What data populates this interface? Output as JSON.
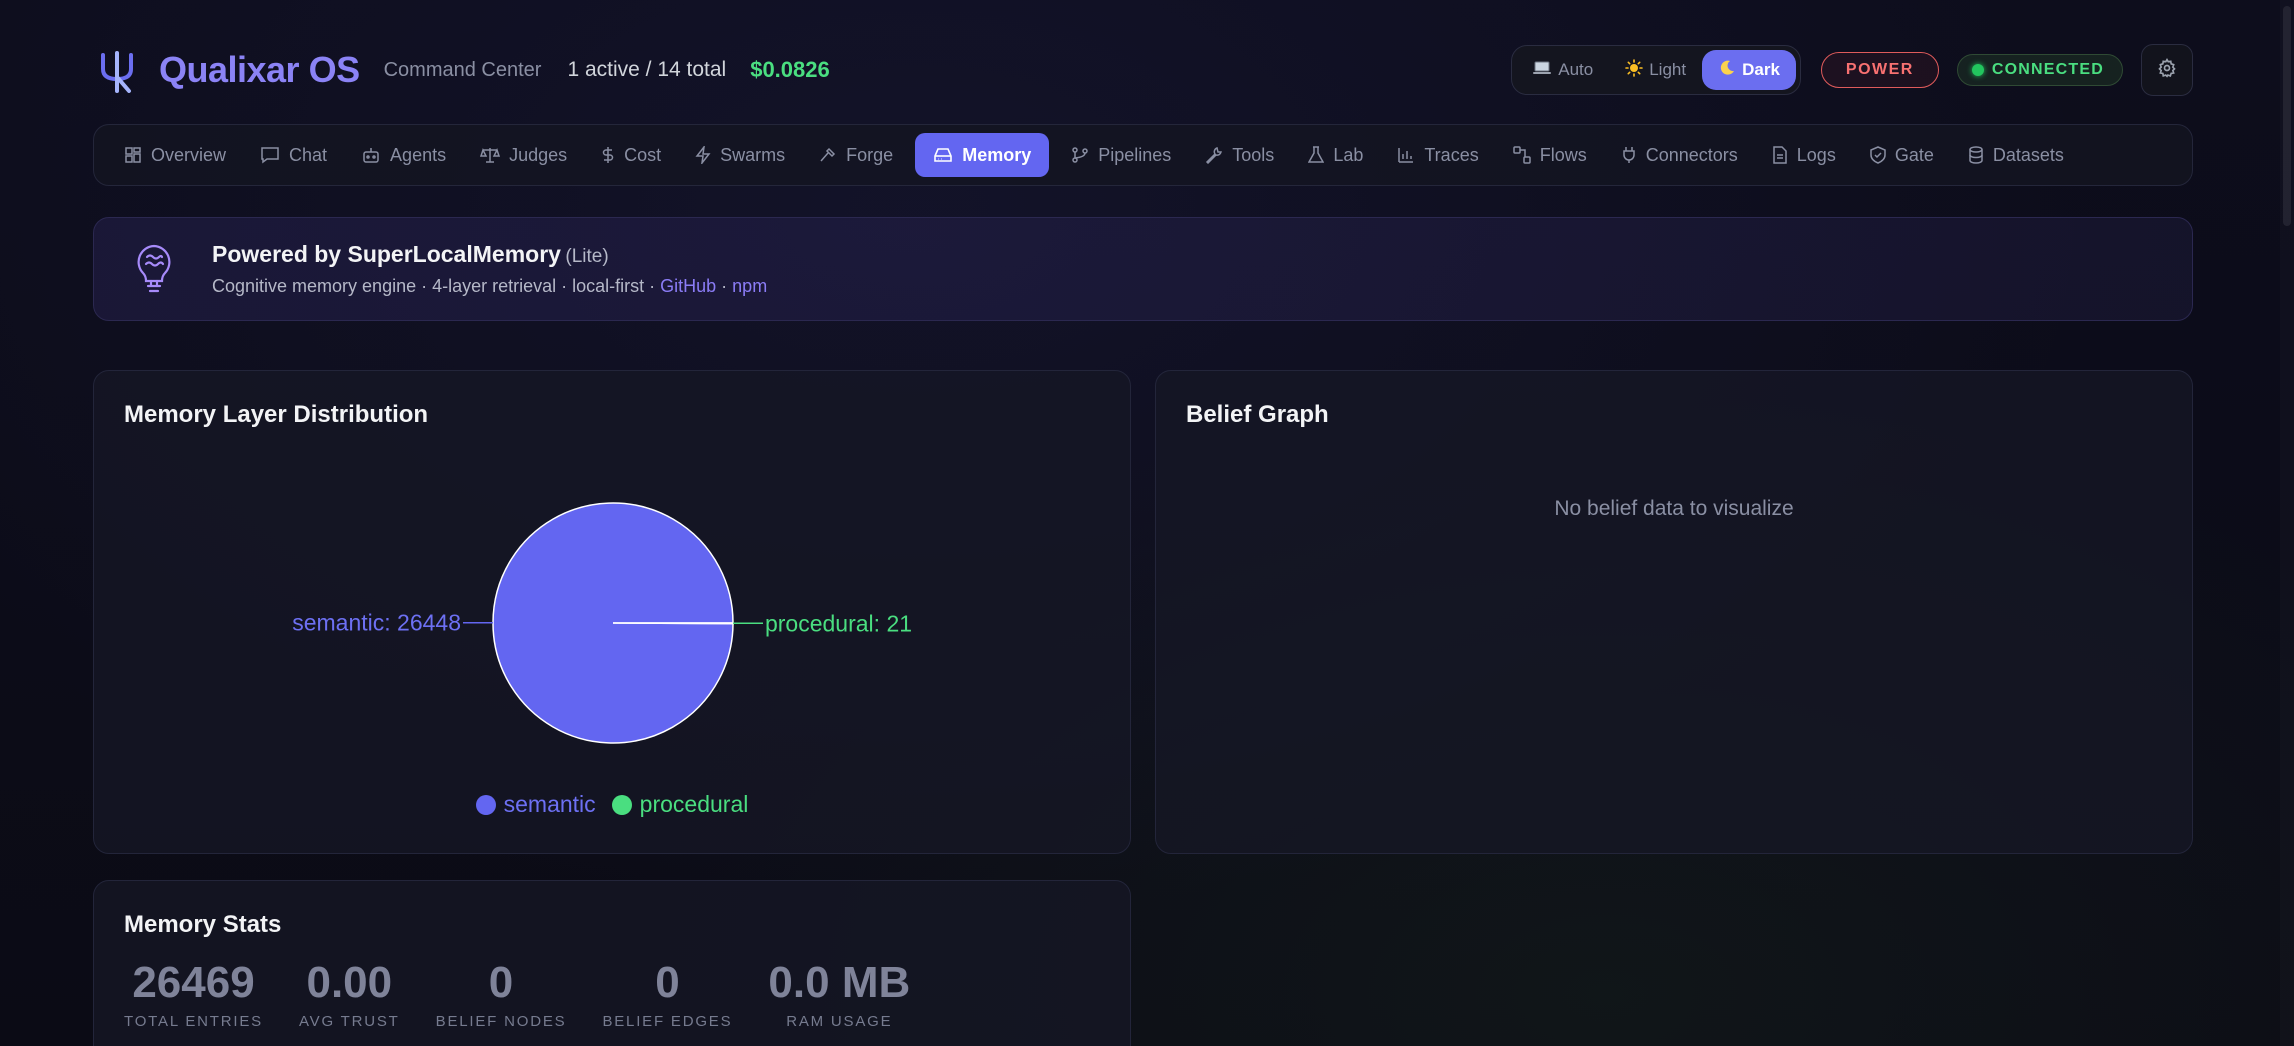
{
  "header": {
    "title": "Qualixar OS",
    "subtitle": "Command Center",
    "stats": "1 active / 14 total",
    "cost": "$0.0826",
    "theme_options": [
      {
        "label": "Auto",
        "icon": "laptop-icon"
      },
      {
        "label": "Light",
        "icon": "sun-icon"
      },
      {
        "label": "Dark",
        "icon": "moon-icon",
        "active": true
      }
    ],
    "power_label": "POWER",
    "connection_label": "CONNECTED"
  },
  "nav": {
    "items": [
      {
        "label": "Overview",
        "icon": "grid-icon"
      },
      {
        "label": "Chat",
        "icon": "chat-icon"
      },
      {
        "label": "Agents",
        "icon": "robot-icon"
      },
      {
        "label": "Judges",
        "icon": "scale-icon"
      },
      {
        "label": "Cost",
        "icon": "dollar-icon"
      },
      {
        "label": "Swarms",
        "icon": "lightning-icon"
      },
      {
        "label": "Forge",
        "icon": "hammer-icon"
      },
      {
        "label": "Memory",
        "icon": "drive-icon",
        "active": true
      },
      {
        "label": "Pipelines",
        "icon": "branch-icon"
      },
      {
        "label": "Tools",
        "icon": "wrench-icon"
      },
      {
        "label": "Lab",
        "icon": "flask-icon"
      },
      {
        "label": "Traces",
        "icon": "bar-chart-icon"
      },
      {
        "label": "Flows",
        "icon": "flow-icon"
      },
      {
        "label": "Connectors",
        "icon": "plug-icon"
      },
      {
        "label": "Logs",
        "icon": "document-icon"
      },
      {
        "label": "Gate",
        "icon": "shield-icon"
      },
      {
        "label": "Datasets",
        "icon": "database-icon"
      }
    ]
  },
  "banner": {
    "title": "Powered by SuperLocalMemory",
    "tag": "(Lite)",
    "desc": "Cognitive memory engine · 4-layer retrieval · local-first · ",
    "link_github": "GitHub",
    "sep": " · ",
    "link_npm": "npm"
  },
  "memory_layer": {
    "title": "Memory Layer Distribution"
  },
  "chart_data": {
    "type": "pie",
    "categories": [
      "semantic",
      "procedural"
    ],
    "values": [
      26448,
      21
    ],
    "colors": [
      "#6366f1",
      "#4ade80"
    ],
    "slice_labels": [
      "semantic: 26448",
      "procedural: 21"
    ],
    "legend": [
      "semantic",
      "procedural"
    ],
    "legend_position": "bottom"
  },
  "belief_graph": {
    "title": "Belief Graph",
    "empty_message": "No belief data to visualize"
  },
  "memory_stats": {
    "title": "Memory Stats",
    "items": [
      {
        "value": "26469",
        "label": "TOTAL ENTRIES"
      },
      {
        "value": "0.00",
        "label": "AVG TRUST"
      },
      {
        "value": "0",
        "label": "BELIEF NODES"
      },
      {
        "value": "0",
        "label": "BELIEF EDGES"
      },
      {
        "value": "0.0 MB",
        "label": "RAM USAGE"
      }
    ]
  }
}
